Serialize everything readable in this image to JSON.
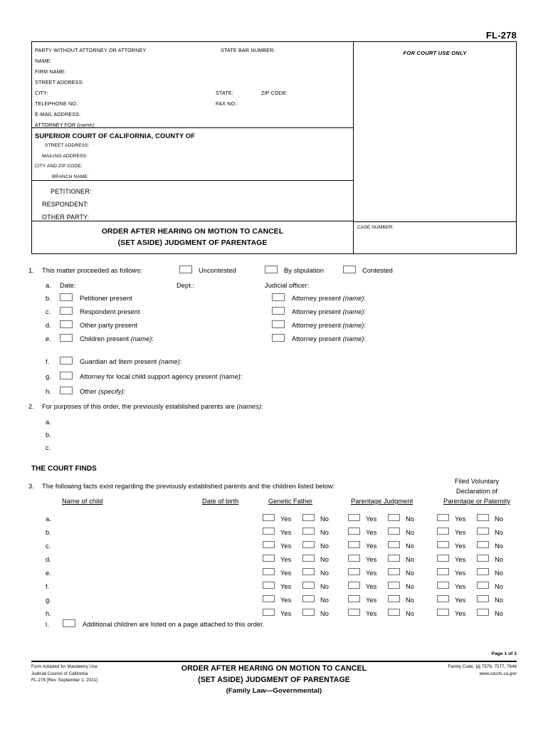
{
  "form_number": "FL-278",
  "caption": {
    "attorney": {
      "header_left": "PARTY WITHOUT ATTORNEY OR ATTORNEY",
      "header_right": "STATE BAR NUMBER:",
      "name": "NAME:",
      "firm_name": "FIRM NAME:",
      "street_address": "STREET ADDRESS:",
      "city": "CITY:",
      "state": "STATE:",
      "zip_code": "ZIP CODE:",
      "telephone_no": "TELEPHONE NO.:",
      "fax_no": "FAX NO.:",
      "email_address": "E-MAIL ADDRESS:",
      "attorney_for": "ATTORNEY FOR ",
      "attorney_for_italic": "(name)",
      "attorney_for_colon": ":"
    },
    "court": {
      "title": "SUPERIOR COURT OF CALIFORNIA, COUNTY OF",
      "street_address": "STREET ADDRESS:",
      "mailing_address": "MAILING ADDRESS:",
      "city_and_zip_code": "CITY AND ZIP CODE:",
      "branch_name": "BRANCH NAME:"
    },
    "parties": {
      "petitioner": "PETITIONER:",
      "respondent": "RESPONDENT:",
      "other_party": "OTHER PARTY:"
    },
    "doc_title_line1": "ORDER AFTER HEARING ON MOTION TO CANCEL",
    "doc_title_line2": "(SET ASIDE) JUDGMENT OF PARENTAGE",
    "for_court_use_only": "FOR COURT USE ONLY",
    "case_number": "CASE NUMBER:"
  },
  "item1": {
    "number": "1.",
    "lead": "This matter proceeded as follows:",
    "option_uncontested": "Uncontested",
    "option_by_stipulation": "By stipulation",
    "option_contested": "Contested",
    "a_letter": "a.",
    "a_date": "Date:",
    "a_dept": "Dept.:",
    "a_judicial_officer": "Judicial officer:",
    "rows": [
      {
        "letter": "b.",
        "label": "Petitioner present",
        "right_label": "Attorney present ",
        "right_italic": "(name)",
        "right_colon": ":"
      },
      {
        "letter": "c.",
        "label": "Respondent present",
        "right_label": "Attorney present ",
        "right_italic": "(name)",
        "right_colon": ":"
      },
      {
        "letter": "d.",
        "label": "Other party present",
        "right_label": "Attorney present ",
        "right_italic": "(name)",
        "right_colon": ":"
      },
      {
        "letter": "e.",
        "label": "Children present ",
        "label_italic": "(name)",
        "label_colon": ":",
        "right_label": "Attorney present ",
        "right_italic": "(name)",
        "right_colon": ":"
      }
    ],
    "f_letter": "f.",
    "f_label": "Guardian ad litem present ",
    "f_italic": "(name)",
    "f_colon": ":",
    "g_letter": "g.",
    "g_label": "Attorney for local child support agency present ",
    "g_italic": "(name)",
    "g_colon": ":",
    "h_letter": "h.",
    "h_label": "Other ",
    "h_italic": "(specify)",
    "h_colon": ":"
  },
  "item2": {
    "number": "2.",
    "text": "For purposes of this order, the previously established parents are ",
    "text_italic": "(names)",
    "text_colon": ":",
    "rows": [
      "a.",
      "b.",
      "c."
    ]
  },
  "court_finds_heading": "THE COURT FINDS",
  "item3": {
    "number": "3.",
    "text": "The following facts exist regarding the previously established parents and the children listed below:",
    "columns": {
      "name_of_child": "Name of child",
      "date_of_birth": "Date of birth",
      "genetic_father": "Genetic Father",
      "parentage_judgment": "Parentage Judgment",
      "filed_voluntary_line1": "Filed Voluntary",
      "filed_voluntary_line2": "Declaration of",
      "filed_voluntary_line3": "Parentage or Paternity"
    },
    "yes_label": "Yes",
    "no_label": "No",
    "rows": [
      "a.",
      "b.",
      "c.",
      "d.",
      "e.",
      "f.",
      "g.",
      "h."
    ],
    "i_letter": "i.",
    "i_label": "Additional children are listed on a page attached to this order."
  },
  "footer": {
    "page_of": "Page 1 of 3",
    "left_line1": "Form Adopted for Mandatory Use",
    "left_line2": "Judicial Council of California",
    "left_line3": "FL-278 [Rev. September 1, 2021]",
    "center_line1": "ORDER AFTER HEARING ON MOTION TO CANCEL",
    "center_line2": "(SET ASIDE) JUDGMENT OF PARENTAGE",
    "center_line3": "(Family Law—Governmental)",
    "right_line1": "Family Code, §§ 7576, 7577, 7646",
    "right_line2": "www.courts.ca.gov"
  }
}
